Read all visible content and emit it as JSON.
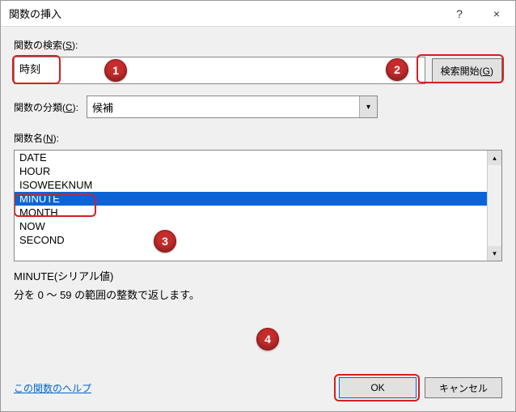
{
  "titlebar": {
    "title": "関数の挿入",
    "help": "?",
    "close": "×"
  },
  "search": {
    "label_prefix": "関数の検索(",
    "label_key": "S",
    "label_suffix": "):",
    "value": "時刻",
    "button_prefix": "検索開始(",
    "button_key": "G",
    "button_suffix": ")"
  },
  "category": {
    "label_prefix": "関数の分類(",
    "label_key": "C",
    "label_suffix": "):",
    "value": "候補"
  },
  "list": {
    "label_prefix": "関数名(",
    "label_key": "N",
    "label_suffix": "):",
    "items": [
      "DATE",
      "HOUR",
      "ISOWEEKNUM",
      "MINUTE",
      "MONTH",
      "NOW",
      "SECOND"
    ],
    "selected": "MINUTE"
  },
  "description": {
    "signature": "MINUTE(シリアル値)",
    "text": "分を 0 ～ 59 の範囲の整数で返します。"
  },
  "footer": {
    "help_link": "この関数のヘルプ",
    "ok": "OK",
    "cancel": "キャンセル"
  },
  "badges": {
    "b1": "1",
    "b2": "2",
    "b3": "3",
    "b4": "4"
  }
}
